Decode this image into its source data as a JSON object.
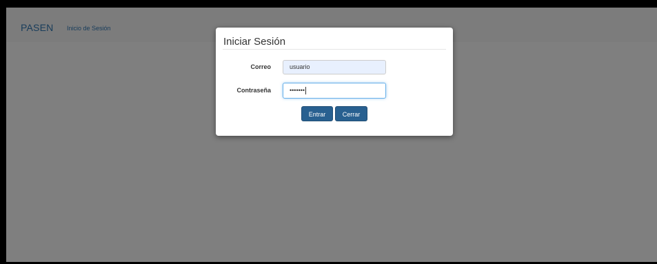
{
  "navbar": {
    "brand": "PASEN",
    "link": "Inicio de Sesión"
  },
  "modal": {
    "title": "Iniciar Sesión",
    "email": {
      "label": "Correo",
      "value": "usuario"
    },
    "password": {
      "label": "Contraseña",
      "masked_value": "•••••••"
    },
    "buttons": {
      "enter": "Entrar",
      "close": "Cerrar"
    }
  },
  "colors": {
    "brand": "#337ab7",
    "primary_button": "#286090",
    "focus_border": "#66afe9",
    "autofill_bg": "#e8f0fe"
  }
}
